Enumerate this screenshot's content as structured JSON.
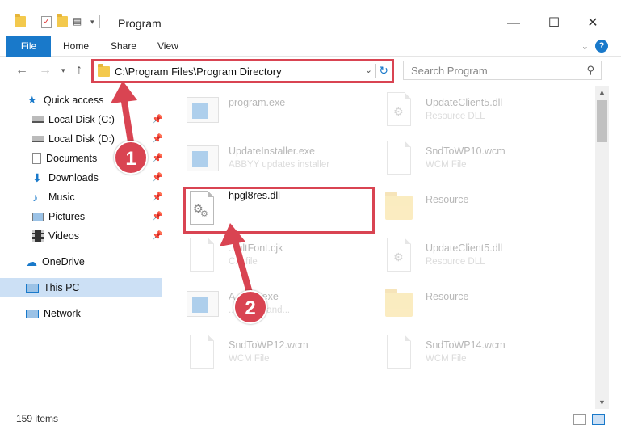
{
  "window": {
    "title": "Program",
    "minimize": "—",
    "maximize": "☐",
    "close": "✕"
  },
  "ribbon": {
    "tabs": [
      "File",
      "Home",
      "Share",
      "View"
    ],
    "help": "?"
  },
  "address": {
    "path": "C:\\Program Files\\Program Directory"
  },
  "search": {
    "placeholder": "Search Program"
  },
  "sidebar": {
    "items": [
      "Quick access",
      "Local Disk (C:)",
      "Local Disk (D:)",
      "Documents",
      "Downloads",
      "Music",
      "Pictures",
      "Videos",
      "OneDrive",
      "This PC",
      "Network"
    ]
  },
  "files": [
    {
      "name": "program.exe",
      "sub": ""
    },
    {
      "name": "UpdateClient5.dll",
      "sub": "Resource DLL"
    },
    {
      "name": "UpdateInstaller.exe",
      "sub": "ABBYY updates installer"
    },
    {
      "name": "SndToWP10.wcm",
      "sub": "WCM File"
    },
    {
      "name": "hpgl8res.dll",
      "sub": ""
    },
    {
      "name": "Resource",
      "sub": ""
    },
    {
      "name": "...ultFont.cjk",
      "sub": "C... file"
    },
    {
      "name": "UpdateClient5.dll",
      "sub": "Resource DLL"
    },
    {
      "name": "A...STI.exe",
      "sub": "...event hand..."
    },
    {
      "name": "Resource",
      "sub": ""
    },
    {
      "name": "SndToWP12.wcm",
      "sub": "WCM File"
    },
    {
      "name": "SndToWP14.wcm",
      "sub": "WCM File"
    }
  ],
  "status": {
    "items": "159 items"
  },
  "steps": {
    "one": "1",
    "two": "2"
  },
  "colors": {
    "accent": "#1979ca",
    "highlight": "#d94452",
    "selected": "#cce0f5"
  }
}
